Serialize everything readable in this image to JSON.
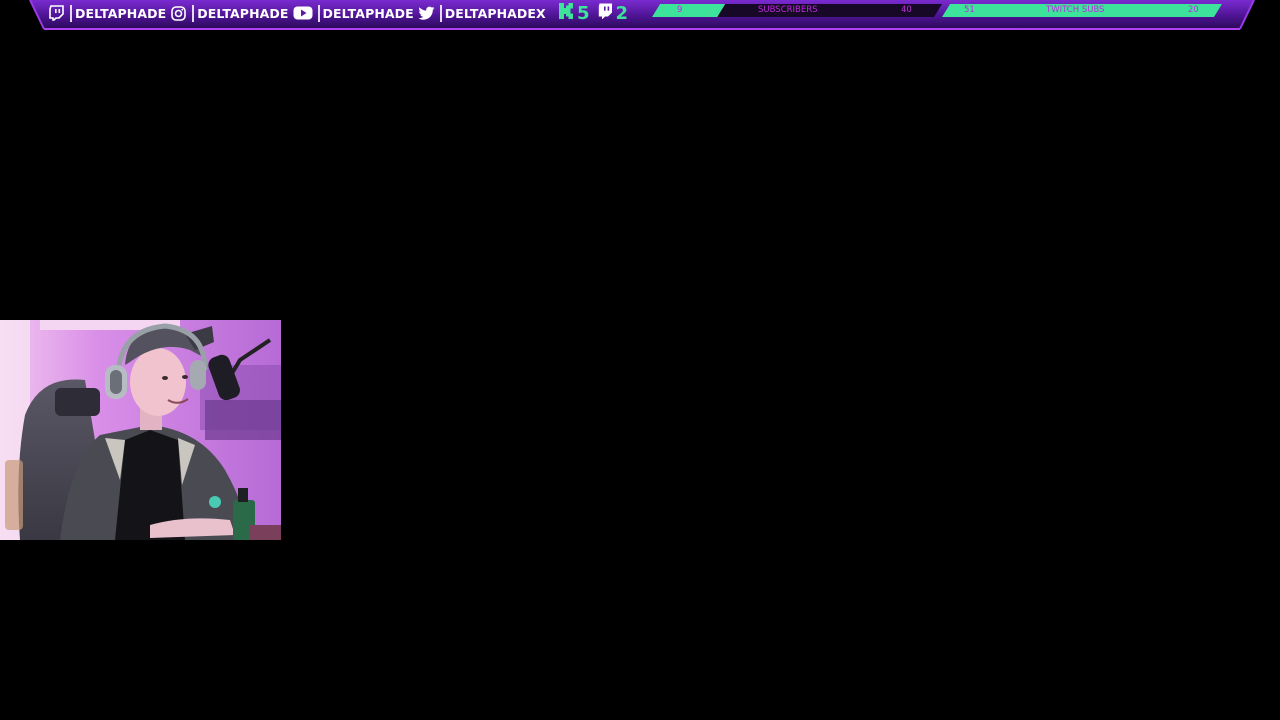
{
  "overlay": {
    "socials": [
      {
        "icon": "twitch-icon",
        "handle": "DELTAPHADE"
      },
      {
        "icon": "instagram-icon",
        "handle": "DELTAPHADE"
      },
      {
        "icon": "youtube-icon",
        "handle": "DELTAPHADE"
      },
      {
        "icon": "twitter-icon",
        "handle": "DELTAPHADEX"
      }
    ],
    "counters": [
      {
        "icon": "kick-icon",
        "value": "5"
      },
      {
        "icon": "twitch-icon",
        "value": "2"
      }
    ],
    "goals": [
      {
        "label": "SUBSCRIBERS",
        "current": "9",
        "target": "40",
        "progress": 0.225
      },
      {
        "label": "TWITCH SUBS",
        "current": "51",
        "target": "20",
        "progress": 1.0
      }
    ]
  },
  "colors": {
    "background": "#000000",
    "bar_purple": "#5a1aa6",
    "bar_edge": "#b040f0",
    "accent_green": "#3de39a",
    "goal_text": "#c028e0",
    "goal_empty": "#160826"
  },
  "webcam": {
    "icon": "webcam-feed"
  }
}
